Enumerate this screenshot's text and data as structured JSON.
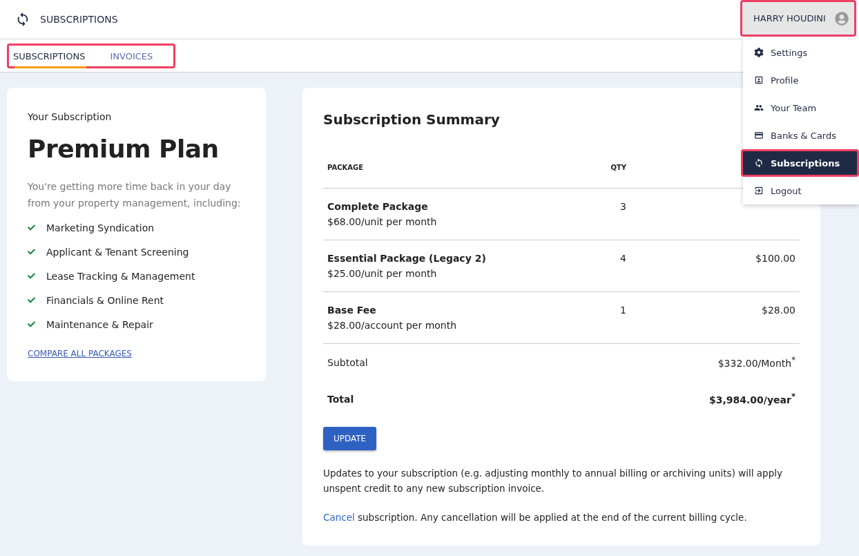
{
  "header": {
    "title": "SUBSCRIPTIONS",
    "user": {
      "name": "HARRY HOUDINI",
      "highlighted": true
    }
  },
  "tabs": {
    "highlighted": true,
    "items": [
      {
        "label": "SUBSCRIPTIONS",
        "selected": true
      },
      {
        "label": "INVOICES",
        "selected": false
      }
    ]
  },
  "user_menu": {
    "items": [
      {
        "label": "Settings",
        "selected": false,
        "highlighted": false
      },
      {
        "label": "Profile",
        "selected": false,
        "highlighted": false
      },
      {
        "label": "Your Team",
        "selected": false,
        "highlighted": false
      },
      {
        "label": "Banks & Cards",
        "selected": false,
        "highlighted": false
      },
      {
        "label": "Subscriptions",
        "selected": true,
        "highlighted": true
      },
      {
        "label": "Logout",
        "selected": false,
        "highlighted": false
      }
    ]
  },
  "plan_card": {
    "caption": "Your Subscription",
    "plan": "Premium Plan",
    "description": "You're getting more time back in your day from your property management, including:",
    "features": [
      "Marketing Syndication",
      "Applicant & Tenant Screening",
      "Lease Tracking & Management",
      "Financials & Online Rent",
      "Maintenance & Repair"
    ],
    "compare_link": "COMPARE ALL PACKAGES"
  },
  "summary": {
    "title": "Subscription Summary",
    "columns": [
      "PACKAGE",
      "QTY"
    ],
    "rows": [
      {
        "name": "Complete Package",
        "rate": "$68.00/unit per month",
        "qty": "3"
      },
      {
        "name": "Essential Package (Legacy 2)",
        "rate": "$25.00/unit per month",
        "qty": "4",
        "amount": "$100.00"
      },
      {
        "name": "Base Fee",
        "rate": "$28.00/account per month",
        "qty": "1",
        "amount": "$28.00"
      }
    ],
    "subtotal": {
      "label": "Subtotal",
      "value": "$332.00/Month$^{*}$"
    },
    "total": {
      "label": "Total",
      "value": "$3,984.00/year$^{*}$"
    },
    "update_button": "UPDATE",
    "note": "Updates to your subscription (e.g. adjusting monthly to annual billing or archiving units) will apply unspent credit to any new subscription invoice.",
    "cancel_link": "Cancel",
    "cancel_text": " subscription. Any cancellation will be applied at the end of the current billing cycle."
  }
}
